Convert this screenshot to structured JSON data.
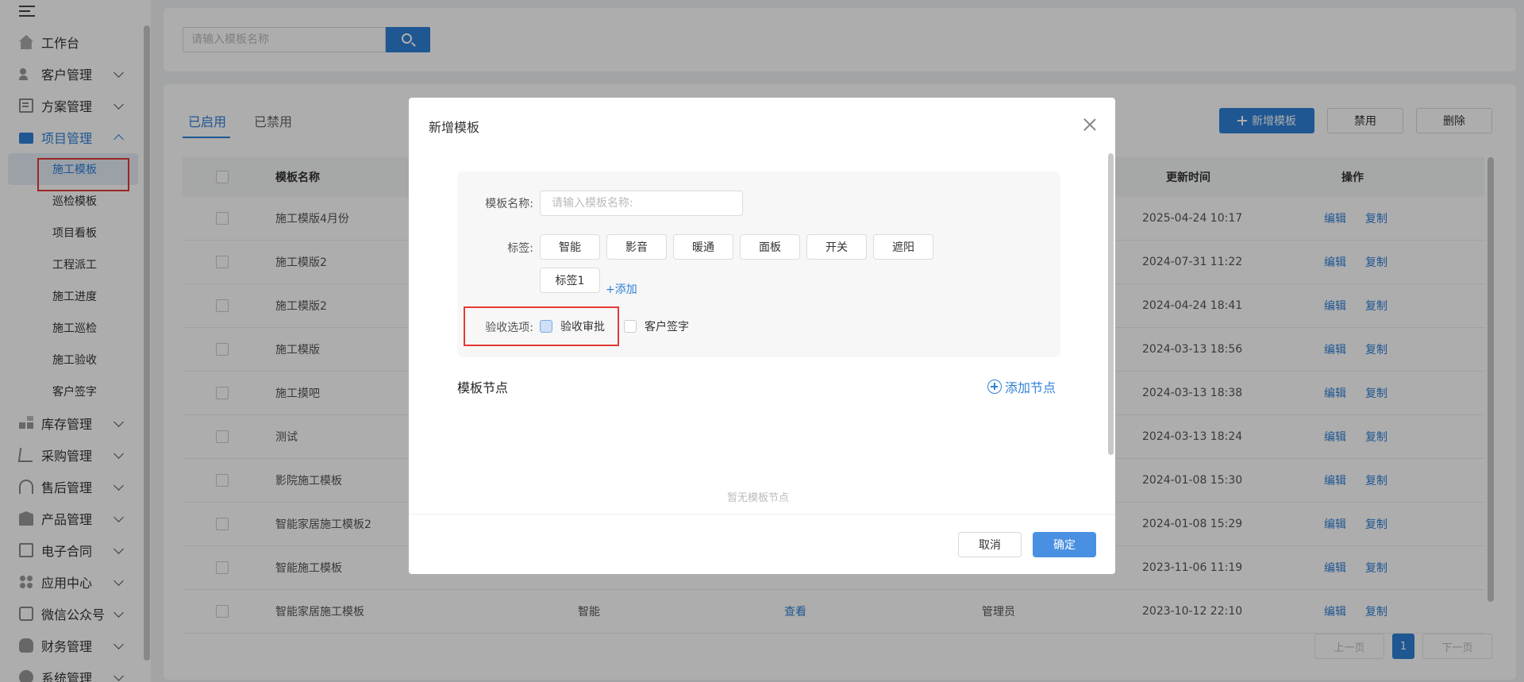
{
  "sidebar": {
    "menu": [
      {
        "label": "工作台",
        "icon": "home-icon"
      },
      {
        "label": "客户管理",
        "icon": "customer-icon"
      },
      {
        "label": "方案管理",
        "icon": "plan-icon"
      },
      {
        "label": "项目管理",
        "icon": "folder-icon"
      },
      {
        "label": "库存管理",
        "icon": "inventory-icon"
      },
      {
        "label": "采购管理",
        "icon": "cart-icon"
      },
      {
        "label": "售后管理",
        "icon": "headset-icon"
      },
      {
        "label": "产品管理",
        "icon": "product-icon"
      },
      {
        "label": "电子合同",
        "icon": "contract-icon"
      },
      {
        "label": "应用中心",
        "icon": "apps-icon"
      },
      {
        "label": "微信公众号",
        "icon": "wechat-icon"
      },
      {
        "label": "财务管理",
        "icon": "finance-icon"
      },
      {
        "label": "系统管理",
        "icon": "settings-icon"
      }
    ],
    "project_sub": [
      "施工模板",
      "巡检模板",
      "项目看板",
      "工程派工",
      "施工进度",
      "施工巡检",
      "施工验收",
      "客户签字"
    ]
  },
  "search": {
    "placeholder": "请输入模板名称"
  },
  "tabs": [
    "已启用",
    "已禁用"
  ],
  "toolbar": {
    "add_label": "新增模板",
    "disable_label": "禁用",
    "delete_label": "删除"
  },
  "table": {
    "headers": {
      "name": "模板名称",
      "updated": "更新时间",
      "ops": "操作"
    },
    "rows": [
      {
        "name": "施工模版4月份",
        "updated": "2025-04-24 10:17"
      },
      {
        "name": "施工模版2",
        "updated": "2024-07-31 11:22"
      },
      {
        "name": "施工模版2",
        "updated": "2024-04-24 18:41"
      },
      {
        "name": "施工模版",
        "updated": "2024-03-13 18:56"
      },
      {
        "name": "施工摸吧",
        "updated": "2024-03-13 18:38"
      },
      {
        "name": "测试",
        "updated": "2024-03-13 18:24"
      },
      {
        "name": "影院施工模板",
        "updated": "2024-01-08 15:30"
      },
      {
        "name": "智能家居施工模板2",
        "updated": "2024-01-08 15:29"
      },
      {
        "name": "智能施工模板",
        "updated": "2023-11-06 11:19"
      },
      {
        "name": "智能家居施工模板",
        "tag": "智能",
        "view": "查看",
        "creator": "管理员",
        "updated": "2023-10-12 22:10"
      }
    ],
    "edit_label": "编辑",
    "copy_label": "复制"
  },
  "pagination": {
    "prev": "上一页",
    "current": "1",
    "next": "下一页"
  },
  "modal": {
    "title": "新增模板",
    "name_label": "模板名称:",
    "name_placeholder": "请输入模板名称:",
    "tags_label": "标签:",
    "tags": [
      "智能",
      "影音",
      "暖通",
      "面板",
      "开关",
      "遮阳",
      "标签1"
    ],
    "add_tag": "+添加",
    "accept_label": "验收选项:",
    "options": [
      "验收审批",
      "客户签字"
    ],
    "nodes_title": "模板节点",
    "add_node": "添加节点",
    "empty": "暂无模板节点",
    "cancel": "取消",
    "confirm": "确定"
  }
}
